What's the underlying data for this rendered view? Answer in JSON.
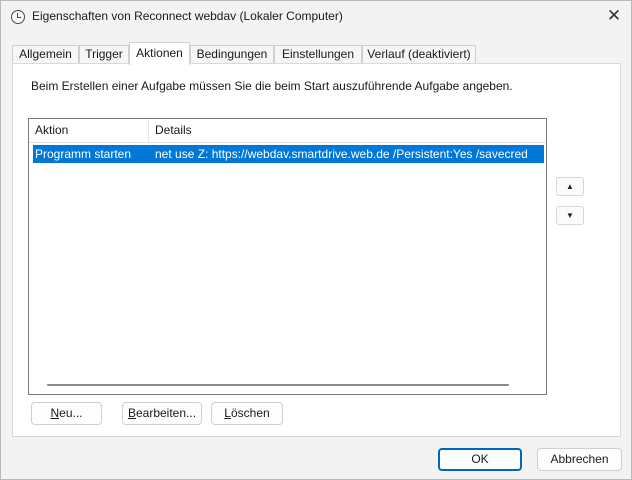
{
  "window": {
    "title": "Eigenschaften von Reconnect webdav (Lokaler Computer)",
    "close_glyph": "✕"
  },
  "tabs": [
    {
      "label": "Allgemein"
    },
    {
      "label": "Trigger"
    },
    {
      "label": "Aktionen"
    },
    {
      "label": "Bedingungen"
    },
    {
      "label": "Einstellungen"
    },
    {
      "label": "Verlauf (deaktiviert)"
    }
  ],
  "active_tab": "Aktionen",
  "panel": {
    "instruction": "Beim Erstellen einer Aufgabe müssen Sie die beim Start auszuführende Aufgabe angeben.",
    "list": {
      "columns": [
        "Aktion",
        "Details"
      ],
      "rows": [
        {
          "action": "Programm starten",
          "details": "net use Z: https://webdav.smartdrive.web.de /Persistent:Yes /savecred",
          "selected": true
        }
      ]
    },
    "move_up_glyph": "▲",
    "move_down_glyph": "▼",
    "buttons": {
      "new_pre": "",
      "new_key": "N",
      "new_post": "eu...",
      "edit_pre": "",
      "edit_key": "B",
      "edit_post": "earbeiten...",
      "delete_pre": "",
      "delete_key": "L",
      "delete_post": "öschen"
    }
  },
  "footer": {
    "ok_label": "OK",
    "cancel_label": "Abbrechen"
  },
  "colors": {
    "selection": "#0078d7",
    "ok_border": "#0067c0"
  }
}
